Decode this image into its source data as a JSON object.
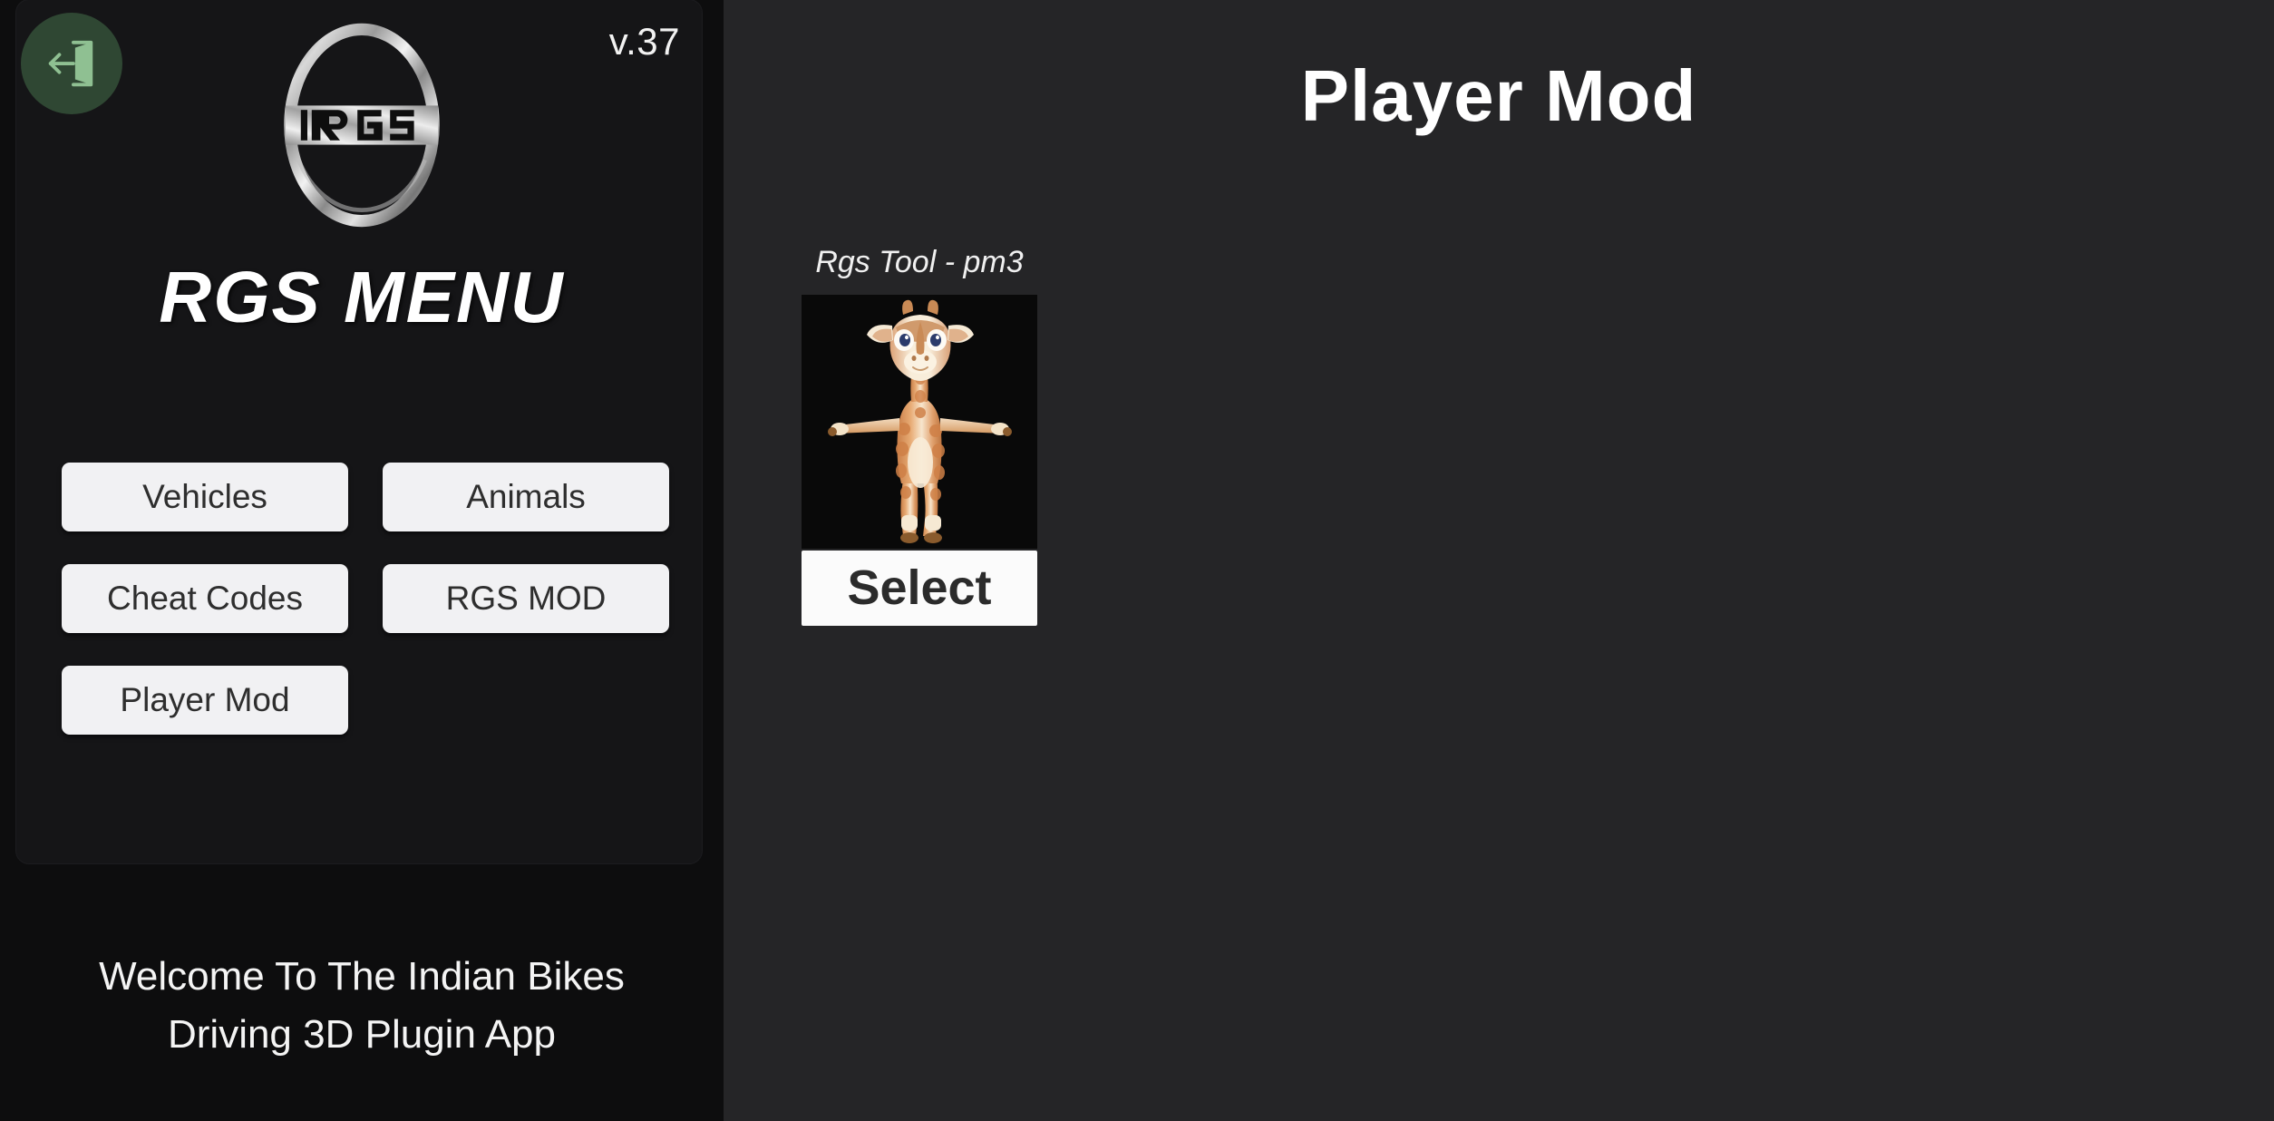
{
  "sidebar": {
    "exit_icon": "exit-door-left-arrow-icon",
    "version": "v.37",
    "logo_icon": "rgs-logo-icon",
    "menu_title": "RGS MENU",
    "buttons": [
      {
        "label": "Vehicles"
      },
      {
        "label": "Animals"
      },
      {
        "label": "Cheat Codes"
      },
      {
        "label": "RGS MOD"
      },
      {
        "label": "Player Mod"
      }
    ],
    "welcome_line1": "Welcome To The Indian Bikes",
    "welcome_line2": "Driving 3D Plugin App"
  },
  "main": {
    "title": "Player Mod",
    "mods": [
      {
        "label": "Rgs Tool - pm3",
        "preview_icon": "giraffe-character-preview",
        "select_label": "Select"
      }
    ]
  },
  "colors": {
    "sidebar_panel": "#151517",
    "main_bg": "#252527",
    "button_bg": "#f1f1f3",
    "button_text": "#2e2e2e",
    "accent_exit": "#2f4733",
    "exit_glyph": "#8fc092",
    "preview_bg": "#090909",
    "text_primary": "#ffffff"
  }
}
